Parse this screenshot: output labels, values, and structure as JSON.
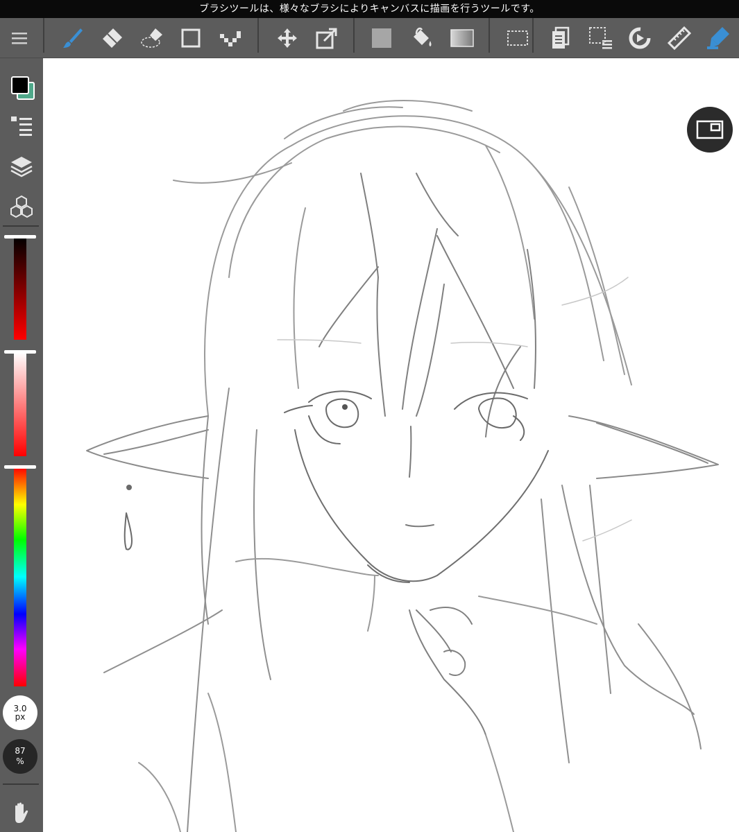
{
  "hint": {
    "text": "ブラシツールは、様々なブラシによりキャンバスに描画を行うツールです。"
  },
  "toolbar": {
    "items": [
      {
        "icon": "menu-icon",
        "active": false
      },
      {
        "icon": "brush-icon",
        "active": true
      },
      {
        "icon": "eraser-icon",
        "active": false
      },
      {
        "icon": "blur-eraser-icon",
        "active": false
      },
      {
        "icon": "shape-icon",
        "active": false
      },
      {
        "icon": "dot-icon",
        "active": false
      },
      {
        "icon": "move-icon",
        "active": false
      },
      {
        "icon": "transform-icon",
        "active": false
      },
      {
        "icon": "fill-rect-icon",
        "active": false
      },
      {
        "icon": "bucket-icon",
        "active": false
      },
      {
        "icon": "gradient-icon",
        "active": false
      },
      {
        "icon": "selection-icon",
        "active": false
      },
      {
        "icon": "layer-copy-icon",
        "active": false
      },
      {
        "icon": "select-menu-icon",
        "active": false
      },
      {
        "icon": "snap-icon",
        "active": false
      },
      {
        "icon": "ruler-icon",
        "active": false
      },
      {
        "icon": "filter-pen-icon",
        "active": true
      }
    ]
  },
  "sidebar": {
    "colors": {
      "primary": "#000000",
      "secondary": "#4fa88a"
    },
    "brush_size": {
      "value": "3.0",
      "unit": "px"
    },
    "opacity": {
      "value": "87",
      "unit": "%"
    },
    "sliders": {
      "brightness_level": 1.0,
      "saturation_level": 0.0,
      "hue_level": 0.0
    }
  },
  "colors": {
    "toolbar_bg": "#5c5c5c",
    "accent": "#3a8fd4",
    "icon": "#e6e6e6"
  }
}
